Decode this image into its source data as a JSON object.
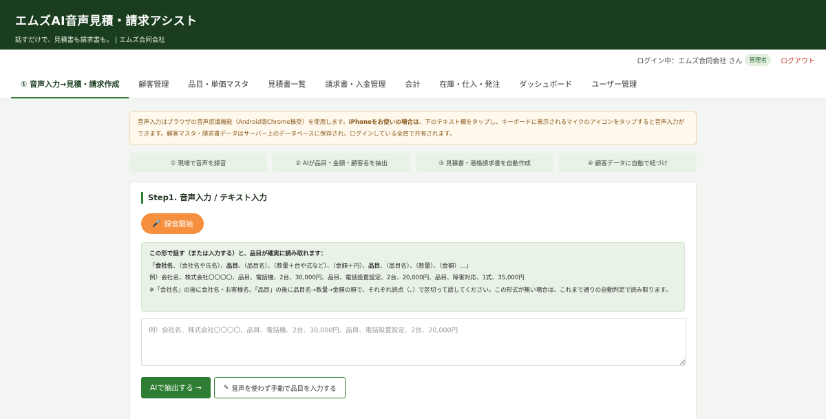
{
  "header": {
    "title": "エムズAI音声見積・請求アシスト",
    "subtitle": "話すだけで、見積書も請求書も。 | エムズ合同会社"
  },
  "userbar": {
    "login_text": "ログイン中：エムズ合同会社 さん",
    "role_badge": "管理者",
    "logout": "ログアウト"
  },
  "nav": {
    "tabs": [
      {
        "label": "① 音声入力→見積・請求作成",
        "active": true
      },
      {
        "label": "顧客管理"
      },
      {
        "label": "品目・単価マスタ"
      },
      {
        "label": "見積書一覧"
      },
      {
        "label": "請求書・入金管理"
      },
      {
        "label": "会計"
      },
      {
        "label": "在庫・仕入・発注"
      },
      {
        "label": "ダッシュボード"
      },
      {
        "label": "ユーザー管理"
      }
    ]
  },
  "notice": {
    "part1": "音声入力はブラウザの音声認識機能（Android版Chrome推奨）を使用します。",
    "bold": "iPhoneをお使いの場合は",
    "part2": "、下のテキスト欄をタップし、キーボードに表示されるマイクのアイコンをタップすると音声入力ができます。顧客マスタ・請求書データはサーバー上のデータベースに保存され、ログインしている全員で共有されます。"
  },
  "steps": [
    "① 現場で音声を録音",
    "② AIが品目・金額・顧客名を抽出",
    "③ 見積書・適格請求書を自動作成",
    "④ 顧客データに自動で紐づけ"
  ],
  "step1": {
    "heading": "Step1. 音声入力 / テキスト入力",
    "record_button": "録音開始",
    "record_icon": "🎤"
  },
  "guide": {
    "title": "この形で話す（または入力する）と、品目が確実に読み取れます：",
    "format": {
      "open": "「",
      "b1": "会社名",
      "t1": "、（会社名や氏名）、",
      "b2": "品目",
      "t2": "、（品目名）、（数量＋台や式など）、（金額＋円）、",
      "b3": "品目",
      "t3": "、（品目名）、（数量）、（金額）…」"
    },
    "example": "例）会社名、株式会社〇〇〇〇、品目、電話機、2台、30,000円、品目、電話設置設定、2台、20,000円、品目、障害対応、1式、35,000円",
    "note": "※「会社名」の後に会社名・お客様名、「品目」の後に品目名→数量→金額の順で、それぞれ読点（、）で区切って話してください。この形式が無い場合は、これまで通りの自動判定で読み取ります。"
  },
  "input": {
    "placeholder": "例）会社名、株式会社〇〇〇〇、品目、電話機、2台、30,000円、品目、電話設置設定、2台、20,000円",
    "value": ""
  },
  "actions": {
    "extract": "AIで抽出する →",
    "manual": "音声を使わず手動で品目を入力する",
    "manual_icon": "✎"
  }
}
